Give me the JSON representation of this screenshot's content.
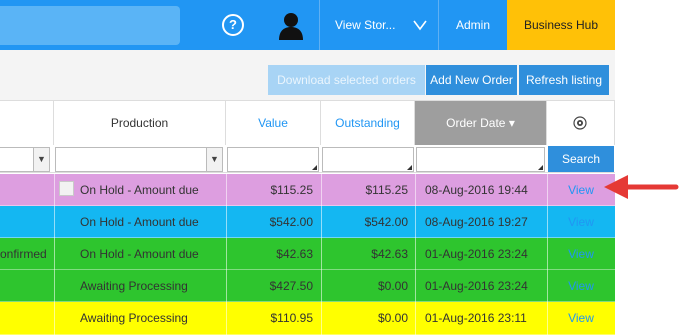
{
  "header": {
    "help_label": "?",
    "store_select_label": "View Stor...",
    "admin_label": "Admin",
    "business_hub_label": "Business Hub"
  },
  "toolbar": {
    "download_label": "Download selected orders",
    "add_order_label": "Add New Order",
    "refresh_label": "Refresh listing"
  },
  "table": {
    "columns": [
      "Production",
      "Value",
      "Outstanding",
      "Order Date",
      ""
    ],
    "sort_indicator": "▾",
    "search_label": "Search",
    "rows": [
      {
        "status": "",
        "production": "On Hold - Amount due",
        "value": "$115.25",
        "outstanding": "$115.25",
        "date": "08-Aug-2016 19:44",
        "action": "View",
        "color": "#dd9ee0"
      },
      {
        "status": "",
        "production": "On Hold - Amount due",
        "value": "$542.00",
        "outstanding": "$542.00",
        "date": "08-Aug-2016 19:27",
        "action": "View",
        "color": "#14b7f2"
      },
      {
        "status": "onfirmed",
        "production": "On Hold - Amount due",
        "value": "$42.63",
        "outstanding": "$42.63",
        "date": "01-Aug-2016 23:24",
        "action": "View",
        "color": "#2ec52e"
      },
      {
        "status": "",
        "production": "Awaiting Processing",
        "value": "$427.50",
        "outstanding": "$0.00",
        "date": "01-Aug-2016 23:24",
        "action": "View",
        "color": "#2ec52e"
      },
      {
        "status": "",
        "production": "Awaiting Processing",
        "value": "$110.95",
        "outstanding": "$0.00",
        "date": "01-Aug-2016 23:11",
        "action": "View",
        "color": "#ffff00"
      }
    ]
  },
  "icons": {
    "help": "help-circle-icon",
    "user": "user-avatar-icon",
    "chevron": "chevron-down-icon",
    "settings": "gear-icon",
    "annotation": "red-arrow-icon"
  },
  "colors": {
    "brand": "#2196f3",
    "accent": "#ffc107",
    "annotation": "#e53935"
  }
}
